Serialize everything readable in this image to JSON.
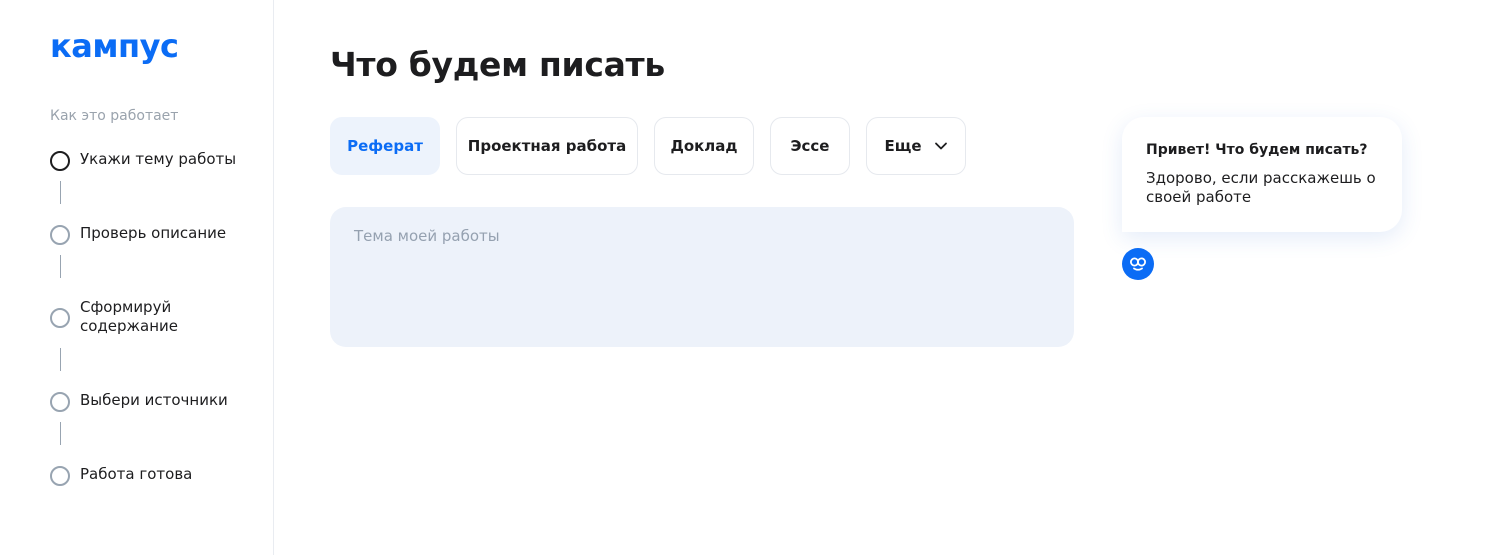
{
  "sidebar": {
    "logo": "кампус",
    "how_it_works": "Как это работает",
    "steps": [
      {
        "label": "Укажи тему работы"
      },
      {
        "label": "Проверь описание"
      },
      {
        "label": "Сформируй содержание"
      },
      {
        "label": "Выбери источники"
      },
      {
        "label": "Работа готова"
      }
    ]
  },
  "main": {
    "title": "Что будем писать",
    "tabs": [
      {
        "label": "Реферат",
        "selected": true
      },
      {
        "label": "Проектная работа"
      },
      {
        "label": "Доклад"
      },
      {
        "label": "Эссе"
      },
      {
        "label": "Еще",
        "icon": "chevron-down-icon"
      }
    ],
    "topic_input": {
      "value": "",
      "placeholder": "Тема моей работы"
    }
  },
  "assistant": {
    "title": "Привет! Что будем писать?",
    "text": "Здорово, если расскажешь о своей работе",
    "avatar_icon": "bot-logo-icon"
  },
  "colors": {
    "accent": "#0b6cf5",
    "input_bg": "#edf2fa",
    "step_ring": "#98a4b1"
  }
}
